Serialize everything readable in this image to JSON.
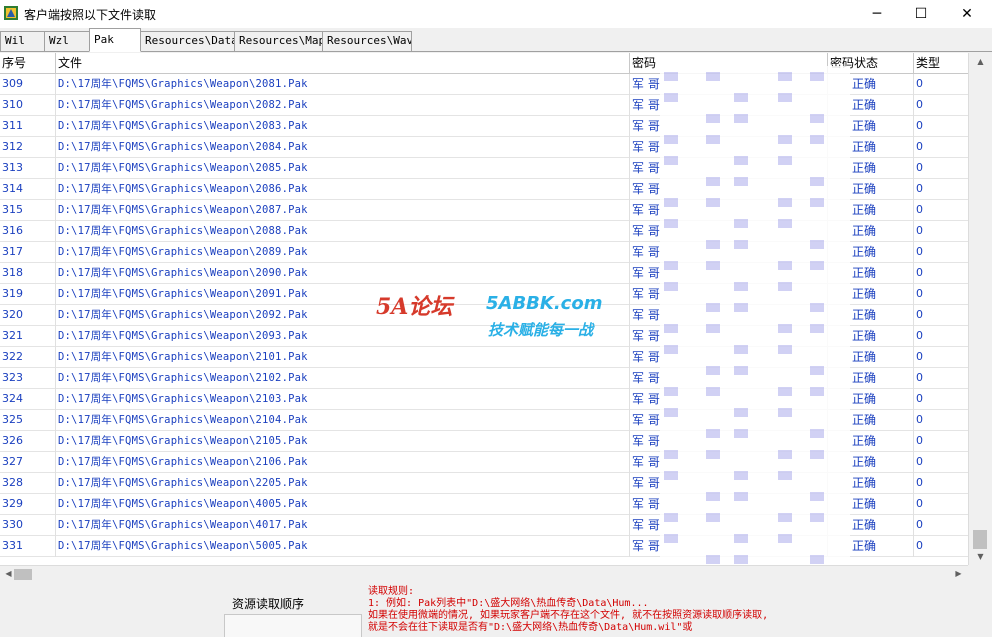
{
  "window": {
    "title": "客户端按照以下文件读取",
    "min_glyph": "─",
    "max_glyph": "☐",
    "close_glyph": "✕"
  },
  "tabs": [
    {
      "label": "Wil"
    },
    {
      "label": "Wzl"
    },
    {
      "label": "Pak",
      "active": true
    },
    {
      "label": "Resources\\Data"
    },
    {
      "label": "Resources\\Map"
    },
    {
      "label": "Resources\\Wav"
    }
  ],
  "table": {
    "columns": [
      "序号",
      "文件",
      "密码",
      "密码状态",
      "类型"
    ],
    "rows": [
      {
        "idx": "309",
        "file": "D:\\17周年\\FQMS\\Graphics\\Weapon\\2081.Pak",
        "password": "军 哥",
        "status": "正确",
        "type": "0"
      },
      {
        "idx": "310",
        "file": "D:\\17周年\\FQMS\\Graphics\\Weapon\\2082.Pak",
        "password": "军 哥",
        "status": "正确",
        "type": "0"
      },
      {
        "idx": "311",
        "file": "D:\\17周年\\FQMS\\Graphics\\Weapon\\2083.Pak",
        "password": "军 哥",
        "status": "正确",
        "type": "0"
      },
      {
        "idx": "312",
        "file": "D:\\17周年\\FQMS\\Graphics\\Weapon\\2084.Pak",
        "password": "军 哥",
        "status": "正确",
        "type": "0"
      },
      {
        "idx": "313",
        "file": "D:\\17周年\\FQMS\\Graphics\\Weapon\\2085.Pak",
        "password": "军 哥",
        "status": "正确",
        "type": "0"
      },
      {
        "idx": "314",
        "file": "D:\\17周年\\FQMS\\Graphics\\Weapon\\2086.Pak",
        "password": "军 哥",
        "status": "正确",
        "type": "0"
      },
      {
        "idx": "315",
        "file": "D:\\17周年\\FQMS\\Graphics\\Weapon\\2087.Pak",
        "password": "军 哥",
        "status": "正确",
        "type": "0"
      },
      {
        "idx": "316",
        "file": "D:\\17周年\\FQMS\\Graphics\\Weapon\\2088.Pak",
        "password": "军 哥",
        "status": "正确",
        "type": "0"
      },
      {
        "idx": "317",
        "file": "D:\\17周年\\FQMS\\Graphics\\Weapon\\2089.Pak",
        "password": "军 哥",
        "status": "正确",
        "type": "0"
      },
      {
        "idx": "318",
        "file": "D:\\17周年\\FQMS\\Graphics\\Weapon\\2090.Pak",
        "password": "军 哥",
        "status": "正确",
        "type": "0"
      },
      {
        "idx": "319",
        "file": "D:\\17周年\\FQMS\\Graphics\\Weapon\\2091.Pak",
        "password": "军 哥",
        "status": "正确",
        "type": "0"
      },
      {
        "idx": "320",
        "file": "D:\\17周年\\FQMS\\Graphics\\Weapon\\2092.Pak",
        "password": "军 哥",
        "status": "正确",
        "type": "0"
      },
      {
        "idx": "321",
        "file": "D:\\17周年\\FQMS\\Graphics\\Weapon\\2093.Pak",
        "password": "军 哥",
        "status": "正确",
        "type": "0"
      },
      {
        "idx": "322",
        "file": "D:\\17周年\\FQMS\\Graphics\\Weapon\\2101.Pak",
        "password": "军 哥",
        "status": "正确",
        "type": "0"
      },
      {
        "idx": "323",
        "file": "D:\\17周年\\FQMS\\Graphics\\Weapon\\2102.Pak",
        "password": "军 哥",
        "status": "正确",
        "type": "0"
      },
      {
        "idx": "324",
        "file": "D:\\17周年\\FQMS\\Graphics\\Weapon\\2103.Pak",
        "password": "军 哥",
        "status": "正确",
        "type": "0"
      },
      {
        "idx": "325",
        "file": "D:\\17周年\\FQMS\\Graphics\\Weapon\\2104.Pak",
        "password": "军 哥",
        "status": "正确",
        "type": "0"
      },
      {
        "idx": "326",
        "file": "D:\\17周年\\FQMS\\Graphics\\Weapon\\2105.Pak",
        "password": "军 哥",
        "status": "正确",
        "type": "0"
      },
      {
        "idx": "327",
        "file": "D:\\17周年\\FQMS\\Graphics\\Weapon\\2106.Pak",
        "password": "军 哥",
        "status": "正确",
        "type": "0"
      },
      {
        "idx": "328",
        "file": "D:\\17周年\\FQMS\\Graphics\\Weapon\\2205.Pak",
        "password": "军 哥",
        "status": "正确",
        "type": "0"
      },
      {
        "idx": "329",
        "file": "D:\\17周年\\FQMS\\Graphics\\Weapon\\4005.Pak",
        "password": "军 哥",
        "status": "正确",
        "type": "0"
      },
      {
        "idx": "330",
        "file": "D:\\17周年\\FQMS\\Graphics\\Weapon\\4017.Pak",
        "password": "军 哥",
        "status": "正确",
        "type": "0"
      },
      {
        "idx": "331",
        "file": "D:\\17周年\\FQMS\\Graphics\\Weapon\\5005.Pak",
        "password": "军 哥",
        "status": "正确",
        "type": "0"
      }
    ]
  },
  "scroll": {
    "up_glyph": "▲",
    "down_glyph": "▼",
    "left_glyph": "◀",
    "right_glyph": "▶"
  },
  "bottom": {
    "order_label": "资源读取顺序",
    "rules": [
      "读取规则:",
      "1: 例如: Pak列表中\"D:\\盛大网络\\热血传奇\\Data\\Hum...",
      "   如果在使用微端的情况, 如果玩家客户端不存在这个文件, 就不在按照资源读取顺序读取,",
      "   就是不会在往下读取是否有\"D:\\盛大网络\\热血传奇\\Data\\Hum.wil\"或"
    ]
  },
  "watermark": {
    "logo_text": "5A论坛",
    "site": "5ABBK.com",
    "slogan": "技术赋能每一战"
  },
  "colors": {
    "row_text": "#1a3fbf",
    "rules_text": "#d20000",
    "watermark_red": "#d63a2b",
    "watermark_blue": "#2ab0e6"
  }
}
